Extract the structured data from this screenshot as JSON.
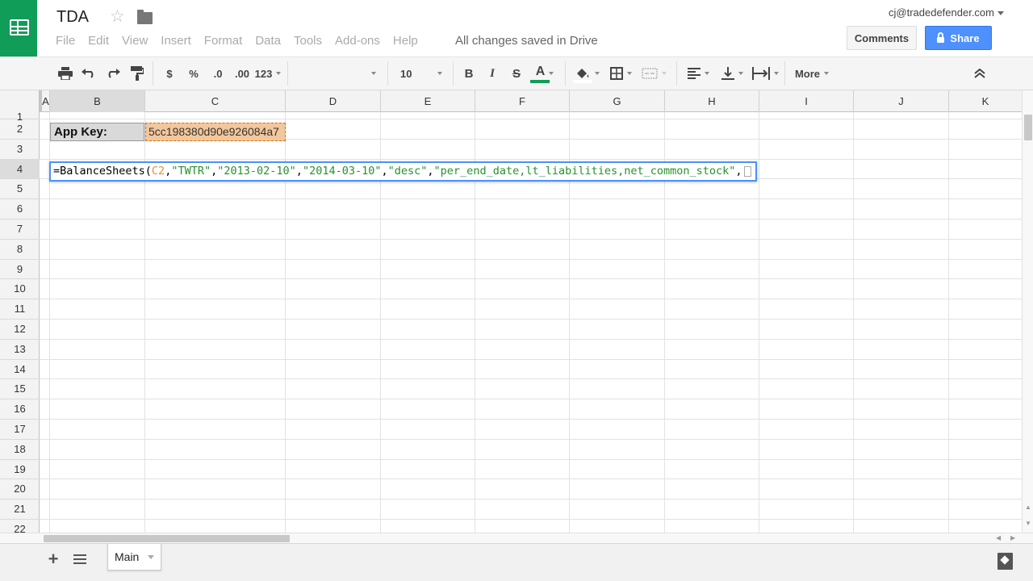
{
  "header": {
    "title": "TDA",
    "menu": [
      "File",
      "Edit",
      "View",
      "Insert",
      "Format",
      "Data",
      "Tools",
      "Add-ons",
      "Help"
    ],
    "save_status": "All changes saved in Drive",
    "user_email": "cj@tradedefender.com",
    "comments_label": "Comments",
    "share_label": "Share"
  },
  "toolbar": {
    "currency": "$",
    "percent": "%",
    "decrease_decimals": ".0",
    "increase_decimals": ".00",
    "number_format": "123",
    "font_name": "",
    "font_size": "10",
    "more_label": "More",
    "text_color": "#0f9d58"
  },
  "grid": {
    "columns": [
      "A",
      "B",
      "C",
      "D",
      "E",
      "F",
      "G",
      "H",
      "I",
      "J",
      "K"
    ],
    "rows": [
      "1",
      "2",
      "3",
      "4",
      "5",
      "6",
      "7",
      "8",
      "9",
      "10",
      "11",
      "12",
      "13",
      "14",
      "15",
      "16",
      "17",
      "18",
      "19",
      "20",
      "21",
      "22"
    ],
    "selected_column": "B",
    "selected_row": "4",
    "b2": "App Key:",
    "c2": "5cc198380d90e926084a7",
    "formula": {
      "prefix": "=BalanceSheets(",
      "ref": "C2",
      "comma1": ",",
      "arg1": "\"TWTR\"",
      "comma2": ",",
      "arg2": "\"2013-02-10\"",
      "comma3": ",",
      "arg3": "\"2014-03-10\"",
      "comma4": ",",
      "arg4": "\"desc\"",
      "comma5": ",",
      "arg5": "\"per_end_date,lt_liabilities,net_common_stock\"",
      "comma6": ","
    }
  },
  "footer": {
    "sheet_tab": "Main"
  }
}
